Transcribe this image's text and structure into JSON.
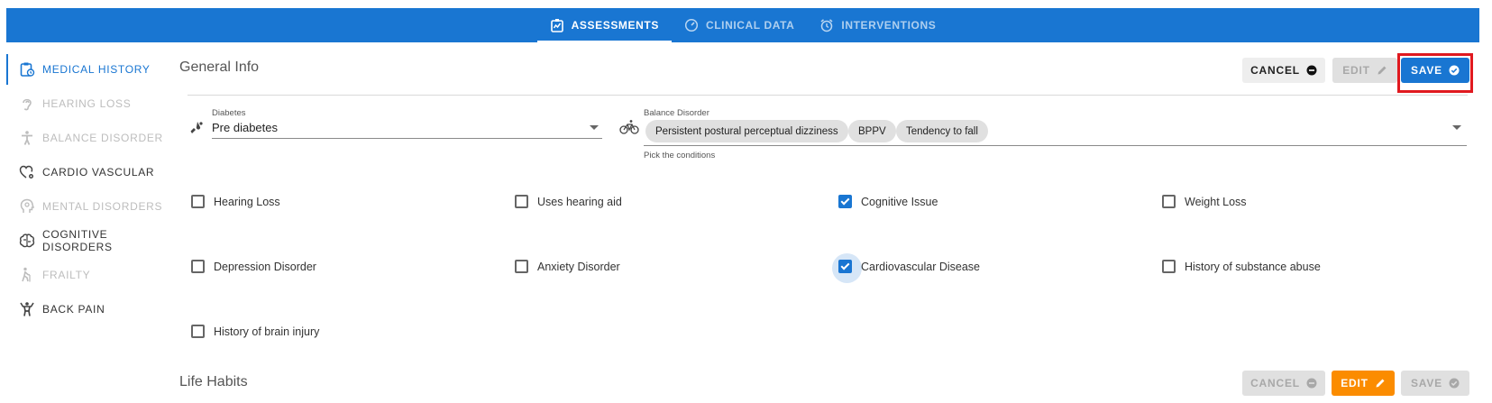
{
  "nav": {
    "tabs": [
      {
        "label": "ASSESSMENTS",
        "icon": "assessment-icon",
        "active": true
      },
      {
        "label": "CLINICAL DATA",
        "icon": "gauge-icon",
        "active": false
      },
      {
        "label": "INTERVENTIONS",
        "icon": "alarm-icon",
        "active": false
      }
    ]
  },
  "sidebar": {
    "items": [
      {
        "label": "MEDICAL HISTORY",
        "icon": "clipboard-clock-icon",
        "state": "active"
      },
      {
        "label": "HEARING LOSS",
        "icon": "ear-icon",
        "state": "disabled"
      },
      {
        "label": "BALANCE DISORDER",
        "icon": "person-icon",
        "state": "disabled"
      },
      {
        "label": "CARDIO VASCULAR",
        "icon": "heart-gear-icon",
        "state": "enabled"
      },
      {
        "label": "MENTAL DISORDERS",
        "icon": "head-icon",
        "state": "disabled"
      },
      {
        "label": "COGNITIVE DISORDERS",
        "icon": "brain-icon",
        "state": "enabled"
      },
      {
        "label": "FRAILTY",
        "icon": "walking-cane-icon",
        "state": "disabled"
      },
      {
        "label": "BACK PAIN",
        "icon": "back-pain-icon",
        "state": "enabled"
      }
    ]
  },
  "general_info": {
    "title": "General Info",
    "cancel_label": "CANCEL",
    "edit_label": "EDIT",
    "save_label": "SAVE",
    "diabetes": {
      "label": "Diabetes",
      "value": "Pre diabetes"
    },
    "balance": {
      "label": "Balance Disorder",
      "chips": [
        "Persistent postural perceptual dizziness",
        "BPPV",
        "Tendency to fall"
      ],
      "hint": "Pick the conditions"
    },
    "conditions": [
      {
        "label": "Hearing Loss",
        "checked": false
      },
      {
        "label": "Uses hearing aid",
        "checked": false
      },
      {
        "label": "Cognitive Issue",
        "checked": true
      },
      {
        "label": "Weight Loss",
        "checked": false
      },
      {
        "label": "Depression Disorder",
        "checked": false
      },
      {
        "label": "Anxiety Disorder",
        "checked": false
      },
      {
        "label": "Cardiovascular Disease",
        "checked": true
      },
      {
        "label": "History of substance abuse",
        "checked": false
      },
      {
        "label": "History of brain injury",
        "checked": false
      }
    ]
  },
  "life_habits": {
    "title": "Life Habits",
    "cancel_label": "CANCEL",
    "edit_label": "EDIT",
    "save_label": "SAVE"
  },
  "colors": {
    "primary": "#1976d2",
    "accent_orange": "#fb8c00",
    "highlight_red": "#e0191f"
  }
}
